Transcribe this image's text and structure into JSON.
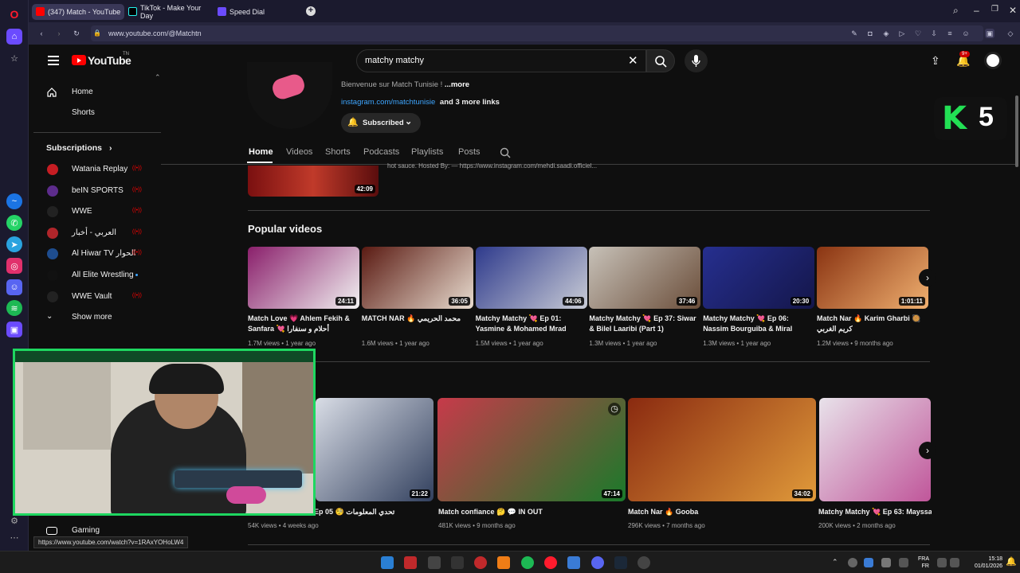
{
  "browser": {
    "tabs": [
      {
        "title": "(347) Match - YouTube",
        "active": true
      },
      {
        "title": "TikTok - Make Your Day",
        "active": false
      },
      {
        "title": "Speed Dial",
        "active": false
      }
    ],
    "new_tab": "+",
    "url": "www.youtube.com/@Matchtn",
    "status_url": "https://www.youtube.com/watch?v=1RAxYOHoLW4"
  },
  "youtube": {
    "logo_text": "YouTube",
    "logo_sup": "TN",
    "search_value": "matchy matchy",
    "notif_count": "9+"
  },
  "guide": {
    "home": "Home",
    "shorts": "Shorts",
    "subscriptions_title": "Subscriptions",
    "subscriptions": [
      {
        "name": "Watania Replay",
        "color": "#c61d23",
        "live": true
      },
      {
        "name": "beIN SPORTS",
        "color": "#5d2c8c",
        "live": true
      },
      {
        "name": "WWE",
        "color": "#222222",
        "live": true
      },
      {
        "name": "العربي - أخبار",
        "color": "#b0252a",
        "live": true
      },
      {
        "name": "Al Hiwar TV الحوار",
        "color": "#1e4d8f",
        "live": true
      },
      {
        "name": "All Elite Wrestling",
        "color": "#111111",
        "live": false
      },
      {
        "name": "WWE Vault",
        "color": "#222222",
        "live": true
      }
    ],
    "show_more": "Show more",
    "gaming": "Gaming"
  },
  "channel": {
    "welcome": "Bienvenue sur Match Tunisie !",
    "more": "...more",
    "link": "instagram.com/matchtunisie",
    "more_links": "and 3 more links",
    "subscribed": "Subscribed",
    "tabs": [
      "Home",
      "Videos",
      "Shorts",
      "Podcasts",
      "Playlists",
      "Posts"
    ],
    "prev_desc": "hot sauce. Hosted By: — https://www.instagram.com/mehdi.saadi.officiel...",
    "prev_duration": "42:09"
  },
  "popular": {
    "title": "Popular videos",
    "videos": [
      {
        "title": "Match Love 💗 Ahlem Fekih & Sanfara 💘 أحلام و سنفارا",
        "views": "1.7M views",
        "age": "1 year ago",
        "duration": "24:11",
        "c1": "#8a1f6b",
        "c2": "#f2f2f2"
      },
      {
        "title": "MATCH NAR 🔥 محمد الحريمي",
        "views": "1.6M views",
        "age": "1 year ago",
        "duration": "36:05",
        "c1": "#5a1a12",
        "c2": "#e8dccf"
      },
      {
        "title": "Matchy Matchy 💘 Ep 01: Yasmine & Mohamed Mrad",
        "views": "1.5M views",
        "age": "1 year ago",
        "duration": "44:06",
        "c1": "#2e3a8c",
        "c2": "#c9ccd6"
      },
      {
        "title": "Matchy Matchy 💘 Ep 37: Siwar & Bilel Laaribi (Part 1)",
        "views": "1.3M views",
        "age": "1 year ago",
        "duration": "37:46",
        "c1": "#c7c1b8",
        "c2": "#6b4e3a"
      },
      {
        "title": "Matchy Matchy 💘 Ep 06: Nassim Bourguiba & Miral",
        "views": "1.3M views",
        "age": "1 year ago",
        "duration": "20:30",
        "c1": "#262f8f",
        "c2": "#14164a"
      },
      {
        "title": "Match Nar 🔥 Karim Gharbi 🥘 كريم الغربي",
        "views": "1.2M views",
        "age": "9 months ago",
        "duration": "1:01:11",
        "c1": "#8a3412",
        "c2": "#f0b070"
      }
    ]
  },
  "second_row": {
    "videos": [
      {
        "title": "Ep 05 🧐 تحدي المعلومات",
        "views": "54K views",
        "age": "4 weeks ago",
        "duration": "21:22",
        "c1": "#d9dde6",
        "c2": "#32405e"
      },
      {
        "title": "Match confiance 🤔 💬 IN OUT",
        "views": "481K views",
        "age": "9 months ago",
        "duration": "47:14",
        "c1": "#c73a4a",
        "c2": "#1a7a2a"
      },
      {
        "title": "Match Nar 🔥 Gooba",
        "views": "296K views",
        "age": "7 months ago",
        "duration": "34:02",
        "c1": "#8a2a10",
        "c2": "#e09a3a"
      },
      {
        "title": "Matchy Matchy 💘 Ep 63: Mayssa",
        "views": "200K views",
        "age": "2 months ago",
        "duration": "",
        "c1": "#e8e2ea",
        "c2": "#c0569a"
      }
    ]
  },
  "overlay": {
    "k": "K",
    "n": "5"
  },
  "taskbar": {
    "lang_top": "FRA",
    "lang_bottom": "FR",
    "time": "15:18",
    "date": "01/01/2026"
  }
}
